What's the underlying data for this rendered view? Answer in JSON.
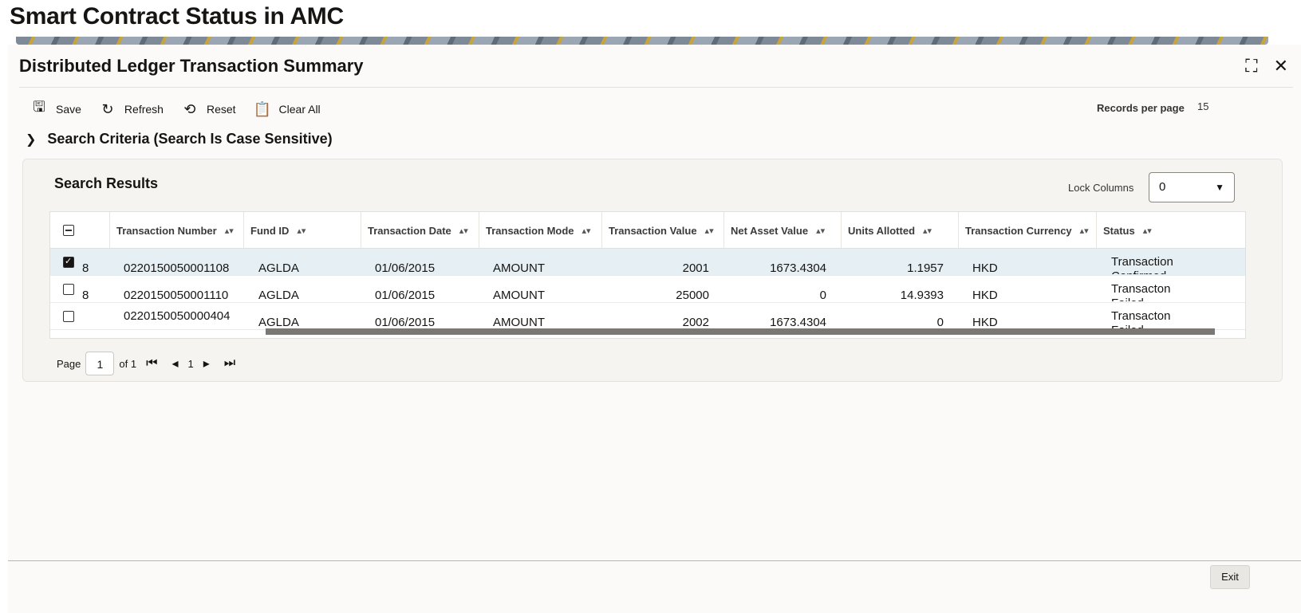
{
  "app": {
    "title": "Smart Contract Status in AMC"
  },
  "window": {
    "title": "Distributed Ledger Transaction Summary"
  },
  "toolbar": {
    "save_label": "Save",
    "refresh_label": "Refresh",
    "reset_label": "Reset",
    "clear_all_label": "Clear All",
    "records_per_page_label": "Records per page",
    "records_per_page_value": "15"
  },
  "search_criteria": {
    "label": "Search Criteria (Search Is Case Sensitive)"
  },
  "results": {
    "title": "Search Results",
    "lock_columns_label": "Lock Columns",
    "lock_columns_value": "0",
    "columns": [
      "Transaction Number",
      "Fund ID",
      "Transaction Date",
      "Transaction Mode",
      "Transaction Value",
      "Net Asset Value",
      "Units Allotted",
      "Transaction Currency",
      "Status"
    ],
    "rows": [
      {
        "prefix": "8",
        "transaction_number": "0220150050001108",
        "fund_id": "AGLDA",
        "transaction_date": "01/06/2015",
        "transaction_mode": "AMOUNT",
        "transaction_value": "2001",
        "nav": "1673.4304",
        "units": "1.1957",
        "currency": "HKD",
        "status": "Transaction Confirmed",
        "checked": true
      },
      {
        "prefix": "8",
        "transaction_number": "0220150050001110",
        "fund_id": "AGLDA",
        "transaction_date": "01/06/2015",
        "transaction_mode": "AMOUNT",
        "transaction_value": "25000",
        "nav": "0",
        "units": "14.9393",
        "currency": "HKD",
        "status": "Transacton Failed",
        "checked": false
      },
      {
        "prefix": "",
        "transaction_number": "0220150050000404",
        "fund_id": "AGLDA",
        "transaction_date": "01/06/2015",
        "transaction_mode": "AMOUNT",
        "transaction_value": "2002",
        "nav": "1673.4304",
        "units": "0",
        "currency": "HKD",
        "status": "Transacton Failed",
        "checked": false
      }
    ]
  },
  "pager": {
    "page_label": "Page",
    "page_value": "1",
    "of_label": "of 1",
    "current": "1"
  },
  "footer": {
    "exit_label": "Exit"
  }
}
